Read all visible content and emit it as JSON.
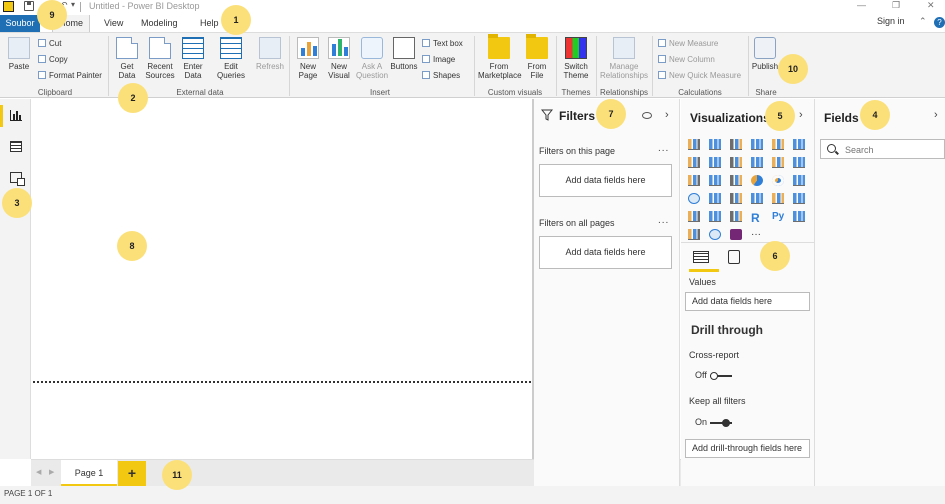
{
  "titlebar": {
    "doc_title": "Untitled - Power BI Desktop",
    "minimize": "—",
    "restore": "❐",
    "close": "✕"
  },
  "menu": {
    "file_tab": "Soubor",
    "tabs": [
      {
        "label": "Home",
        "active": true
      },
      {
        "label": "View",
        "active": false
      },
      {
        "label": "Modeling",
        "active": false
      },
      {
        "label": "Help",
        "active": false
      }
    ],
    "signin": "Sign in",
    "help_icon": "?"
  },
  "ribbon": {
    "clipboard": {
      "paste": "Paste",
      "cut": "Cut",
      "copy": "Copy",
      "format_painter": "Format Painter",
      "label": "Clipboard"
    },
    "external_data": {
      "get_data": "Get Data",
      "recent_sources": "Recent Sources",
      "enter_data": "Enter Data",
      "edit_queries": "Edit Queries",
      "refresh": "Refresh",
      "label": "External data"
    },
    "insert": {
      "new_page": "New Page",
      "new_visual": "New Visual",
      "ask_question": "Ask A Question",
      "buttons": "Buttons",
      "text_box": "Text box",
      "image": "Image",
      "shapes": "Shapes",
      "label": "Insert"
    },
    "custom_visuals": {
      "from_marketplace": "From Marketplace",
      "from_file": "From File",
      "label": "Custom visuals"
    },
    "themes": {
      "switch_theme": "Switch Theme",
      "label": "Themes"
    },
    "relationships": {
      "manage": "Manage Relationships",
      "label": "Relationships"
    },
    "calculations": {
      "new_measure": "New Measure",
      "new_column": "New Column",
      "new_quick_measure": "New Quick Measure",
      "label": "Calculations"
    },
    "share": {
      "publish": "Publish",
      "label": "Share"
    }
  },
  "filters": {
    "title": "Filters",
    "on_this_page": "Filters on this page",
    "on_all_pages": "Filters on all pages",
    "add_fields": "Add data fields here",
    "more": "..."
  },
  "visualizations": {
    "title": "Visualizations",
    "values_label": "Values",
    "values_placeholder": "Add data fields here",
    "drill_through": "Drill through",
    "cross_report": "Cross-report",
    "cross_report_state": "Off",
    "keep_all_filters": "Keep all filters",
    "keep_all_filters_state": "On",
    "drill_placeholder": "Add drill-through fields here",
    "more": "···",
    "r_icon": "R",
    "py_icon": "Py"
  },
  "fields": {
    "title": "Fields",
    "search_placeholder": "Search"
  },
  "pages": {
    "tabs": [
      "Page 1"
    ],
    "add": "+",
    "prev": "◀",
    "next": "▶"
  },
  "status": {
    "text": "PAGE 1 OF 1"
  },
  "callouts": [
    "1",
    "2",
    "3",
    "4",
    "5",
    "6",
    "7",
    "8",
    "9",
    "10",
    "11"
  ],
  "colors": {
    "accent": "#f2c811",
    "file_tab": "#1f6fb5",
    "callout": "#fbe07a"
  }
}
